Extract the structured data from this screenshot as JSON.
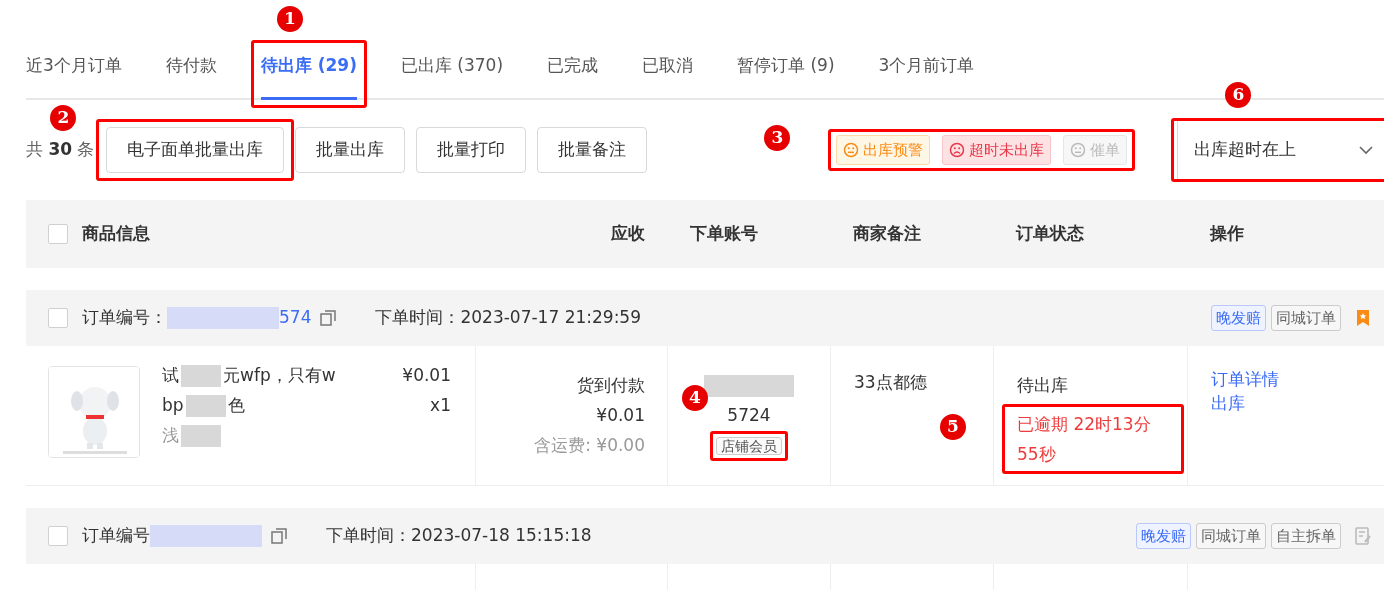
{
  "tabs": [
    {
      "label": "近3个月订单",
      "selected": false
    },
    {
      "label": "待付款",
      "selected": false
    },
    {
      "label": "待出库 (29)",
      "selected": true
    },
    {
      "label": "已出库 (370)",
      "selected": false
    },
    {
      "label": "已完成",
      "selected": false
    },
    {
      "label": "已取消",
      "selected": false
    },
    {
      "label": "暂停订单 (9)",
      "selected": false
    },
    {
      "label": "3个月前订单",
      "selected": false
    }
  ],
  "toolbar": {
    "total": "共 **30** 条",
    "buttons": [
      "电子面单批量出库",
      "批量出库",
      "批量打印",
      "批量备注"
    ],
    "filters": [
      {
        "label": "出库预警",
        "kind": "warning"
      },
      {
        "label": "超时未出库",
        "kind": "overdue"
      },
      {
        "label": "催单",
        "kind": "muted"
      }
    ],
    "sort": {
      "value": "出库超时在上"
    }
  },
  "table": {
    "checked": false,
    "columns": [
      "商品信息",
      "应收",
      "下单账号",
      "商家备注",
      "订单状态",
      "操作"
    ]
  },
  "orders": [
    {
      "checked": false,
      "order_no_label": "订单编号：",
      "order_no": "574",
      "time_label": "下单时间：",
      "time": "2023-07-17 21:29:59",
      "tags": [
        {
          "label": "晚发赔",
          "kind": "blue"
        },
        {
          "label": "同城订单",
          "kind": "grey"
        }
      ],
      "marker": {
        "kind": "bookmark"
      },
      "item": {
        "title_lines": [
          [
            "试",
            "元wfp，只有w"
          ],
          [
            "bp",
            "色"
          ],
          [
            "浅"
          ]
        ],
        "price": "¥0.01",
        "qty": "x1",
        "payment": "货到付款",
        "amount": "¥0.01",
        "shipping": "含运费: ¥0.00",
        "account": "5724",
        "account_tag": "店铺会员",
        "remark": "33点都德",
        "status": "待出库",
        "overdue": "已逾期 22时13分55秒",
        "actions": [
          "订单详情",
          "出库"
        ]
      }
    },
    {
      "checked": false,
      "order_no_label": "订单编号",
      "time_label": "下单时间：",
      "time": "2023-07-18 15:15:18",
      "tags": [
        {
          "label": "晚发赔",
          "kind": "blue"
        },
        {
          "label": "同城订单",
          "kind": "grey"
        },
        {
          "label": "自主拆单",
          "kind": "grey"
        }
      ],
      "marker": {
        "kind": "note"
      }
    }
  ],
  "annotations": [
    {
      "number": "1"
    },
    {
      "number": "2"
    },
    {
      "number": "3"
    },
    {
      "number": "4"
    },
    {
      "number": "5"
    },
    {
      "number": "6"
    }
  ]
}
